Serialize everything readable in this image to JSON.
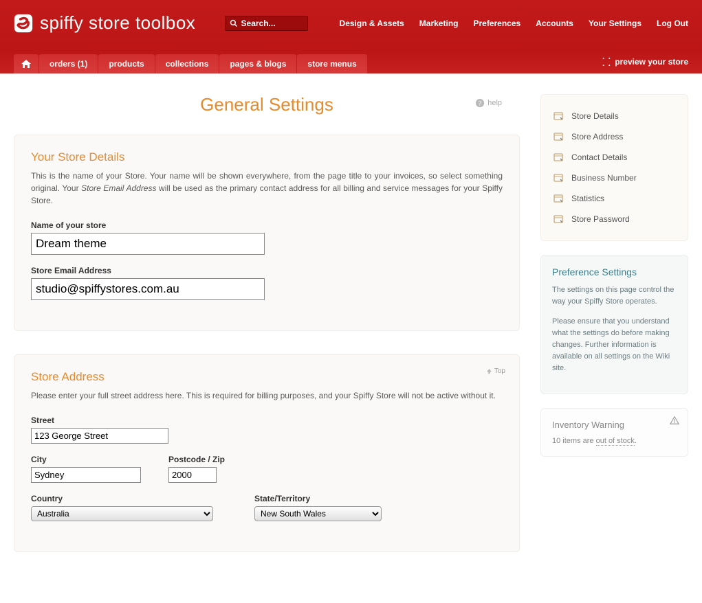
{
  "brand": "spiffy store toolbox",
  "search_placeholder": "Search...",
  "top_links": [
    "Design & Assets",
    "Marketing",
    "Preferences",
    "Accounts",
    "Your Settings",
    "Log Out"
  ],
  "tabs": {
    "orders": "orders (1)",
    "products": "products",
    "collections": "collections",
    "pages": "pages & blogs",
    "menus": "store menus"
  },
  "preview_label": "preview your store",
  "page_title": "General Settings",
  "help_label": "help",
  "store_details": {
    "heading": "Your Store Details",
    "desc_pre": "This is the name of your Store. Your name will be shown everywhere, from the page title to your invoices, so select something original. Your ",
    "desc_em": "Store Email Address",
    "desc_post": " will be used as the primary contact address for all billing and service messages for your Spiffy Store.",
    "name_label": "Name of your store",
    "name_value": "Dream theme",
    "email_label": "Store Email Address",
    "email_value": "studio@spiffystores.com.au"
  },
  "address": {
    "heading": "Store Address",
    "top_label": "Top",
    "desc": "Please enter your full street address here. This is required for billing purposes, and your Spiffy Store will not be active without it.",
    "street_label": "Street",
    "street_value": "123 George Street",
    "city_label": "City",
    "city_value": "Sydney",
    "postcode_label": "Postcode / Zip",
    "postcode_value": "2000",
    "country_label": "Country",
    "country_value": "Australia",
    "state_label": "State/Territory",
    "state_value": "New South Wales"
  },
  "side_nav": [
    "Store Details",
    "Store Address",
    "Contact Details",
    "Business Number",
    "Statistics",
    "Store Password"
  ],
  "pref_box": {
    "title": "Preference Settings",
    "p1": "The settings on this page control the way your Spiffy Store operates.",
    "p2": "Please ensure that you understand what the settings do before making changes. Further information is available on all settings on the Wiki site."
  },
  "inv_box": {
    "title": "Inventory Warning",
    "text_pre": "10 items are ",
    "text_link": "out of stock",
    "text_post": "."
  }
}
